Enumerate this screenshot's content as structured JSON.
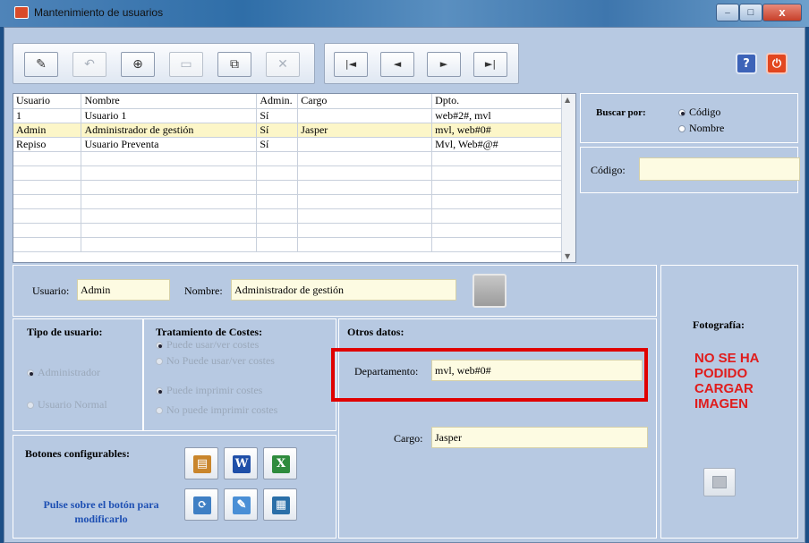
{
  "window": {
    "title": "Mantenimiento de usuarios",
    "close_glyph": "x",
    "min_glyph": "–",
    "max_glyph": "□"
  },
  "toolbar": {
    "buttons": [
      {
        "icon": "edit-icon",
        "glyph": "✎"
      },
      {
        "icon": "undo-icon",
        "glyph": "↶"
      },
      {
        "icon": "new-record-icon",
        "glyph": "⊕"
      },
      {
        "icon": "save-icon",
        "glyph": "▭"
      },
      {
        "icon": "copy-icon",
        "glyph": "⧉"
      },
      {
        "icon": "delete-icon",
        "glyph": "✕"
      }
    ],
    "nav": [
      {
        "icon": "first-record-icon",
        "glyph": "|◄"
      },
      {
        "icon": "prev-record-icon",
        "glyph": "◄"
      },
      {
        "icon": "next-record-icon",
        "glyph": "►"
      },
      {
        "icon": "last-record-icon",
        "glyph": "►|"
      }
    ],
    "help_glyph": "?",
    "exit_glyph": "⏻",
    "help_color": "#3d63b8",
    "exit_color": "#e2461f"
  },
  "grid": {
    "columns": [
      "Usuario",
      "Nombre",
      "Admin.",
      "Cargo",
      "Dpto."
    ],
    "rows": [
      [
        "1",
        "Usuario 1",
        "Sí",
        "",
        "web#2#, mvl"
      ],
      [
        "Admin",
        "Administrador de gestión",
        "Sí",
        "Jasper",
        "mvl, web#0#"
      ],
      [
        "Repiso",
        "Usuario Preventa",
        "Sí",
        "",
        "Mvl, Web#@#"
      ],
      [
        "",
        "",
        "",
        "",
        ""
      ],
      [
        "",
        "",
        "",
        "",
        ""
      ],
      [
        "",
        "",
        "",
        "",
        ""
      ],
      [
        "",
        "",
        "",
        "",
        ""
      ],
      [
        "",
        "",
        "",
        "",
        ""
      ],
      [
        "",
        "",
        "",
        "",
        ""
      ],
      [
        "",
        "",
        "",
        "",
        ""
      ]
    ],
    "selected_row": 1
  },
  "search": {
    "label": "Buscar por:",
    "options": [
      "Código",
      "Nombre"
    ],
    "selected": "Código",
    "codigo_label": "Código:",
    "codigo_value": ""
  },
  "detail": {
    "usuario_label": "Usuario:",
    "usuario_value": "Admin",
    "nombre_label": "Nombre:",
    "nombre_value": "Administrador de gestión"
  },
  "tipo_usuario": {
    "title": "Tipo de usuario:",
    "options": [
      "Administrador",
      "Usuario Normal"
    ],
    "selected": "Administrador"
  },
  "costes": {
    "title": "Tratamiento de Costes:",
    "options": [
      "Puede usar/ver costes",
      "No Puede usar/ver costes",
      "Puede imprimir costes",
      "No puede imprimir costes"
    ]
  },
  "otros": {
    "title": "Otros datos:",
    "departamento_label": "Departamento:",
    "departamento_value": "mvl, web#0#",
    "cargo_label": "Cargo:",
    "cargo_value": "Jasper",
    "highlight_color": "#e00000"
  },
  "foto": {
    "title": "Fotografía:",
    "message": "NO SE HA PODIDO CARGAR IMAGEN"
  },
  "botones": {
    "title": "Botones configurables:",
    "hint": "Pulse sobre el botón para modificarlo",
    "buttons": [
      {
        "icon": "report-icon",
        "glyph": "▤",
        "color": "#c9852b"
      },
      {
        "icon": "word-icon",
        "glyph": "W",
        "color": "#1f4fa8"
      },
      {
        "icon": "excel-icon",
        "glyph": "X",
        "color": "#2e8b3d"
      },
      {
        "icon": "sync-icon",
        "glyph": "⟳",
        "color": "#3f7fc4"
      },
      {
        "icon": "notepad-icon",
        "glyph": "✎",
        "color": "#4a8fd6"
      },
      {
        "icon": "calculator-icon",
        "glyph": "▦",
        "color": "#2b6fa8"
      }
    ]
  }
}
